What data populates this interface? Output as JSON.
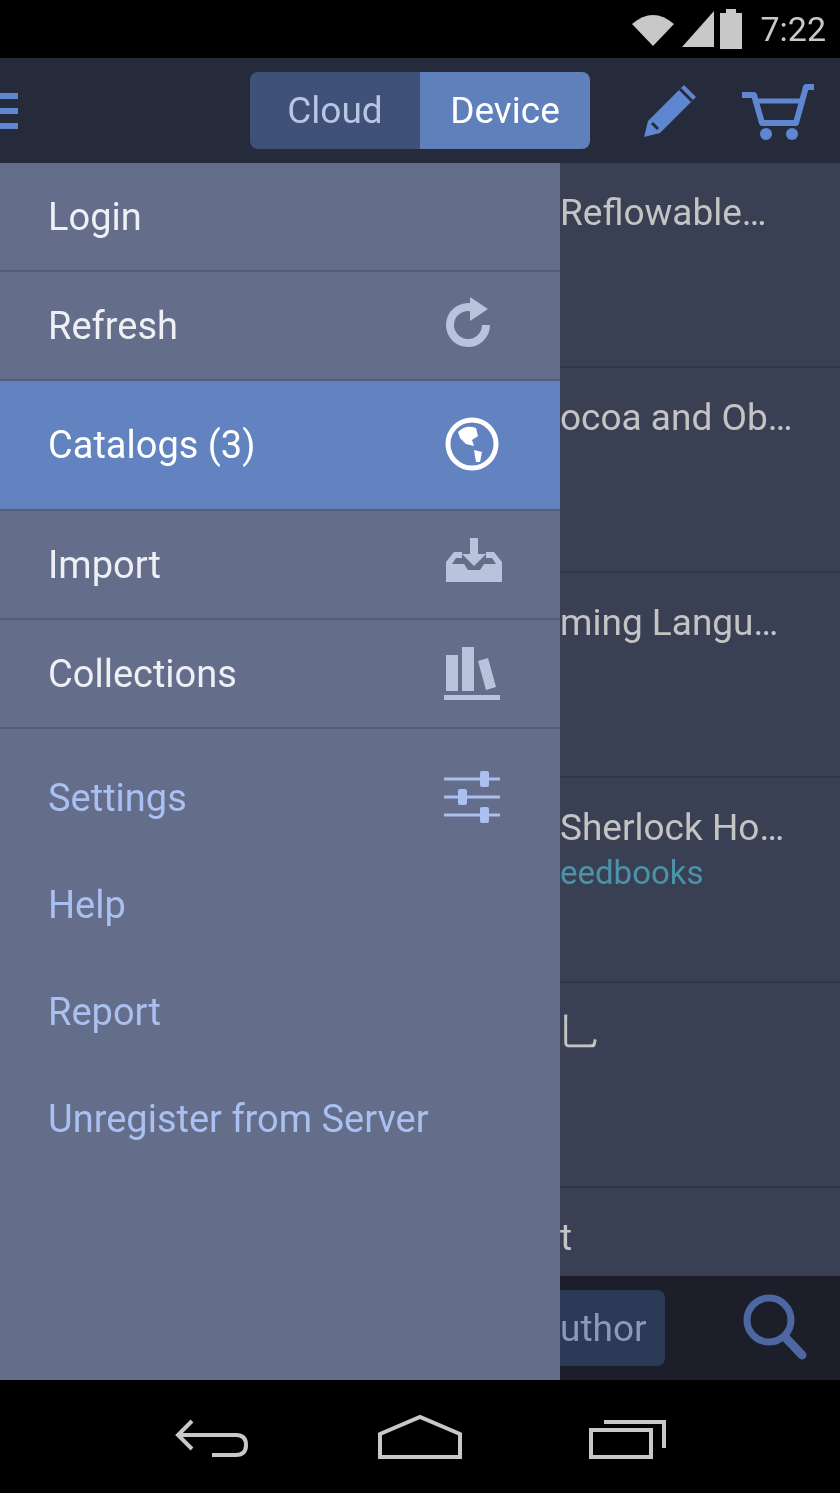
{
  "status_bar": {
    "time": "7:22"
  },
  "app_bar": {
    "segments": [
      {
        "label": "Cloud",
        "selected": false
      },
      {
        "label": "Device",
        "selected": true
      }
    ]
  },
  "drawer": {
    "items": [
      {
        "label": "Login",
        "kind": "primary",
        "selected": false
      },
      {
        "label": "Refresh",
        "kind": "primary",
        "selected": false
      },
      {
        "label": "Catalogs (3)",
        "kind": "primary",
        "selected": true
      },
      {
        "label": "Import",
        "kind": "primary",
        "selected": false
      },
      {
        "label": "Collections",
        "kind": "primary",
        "selected": false
      },
      {
        "label": "Settings",
        "kind": "secondary",
        "selected": false
      },
      {
        "label": "Help",
        "kind": "secondary",
        "selected": false
      },
      {
        "label": "Report",
        "kind": "secondary",
        "selected": false
      },
      {
        "label": "Unregister from Server",
        "kind": "secondary",
        "selected": false
      }
    ]
  },
  "book_list": {
    "rows": [
      {
        "title": "Reflowable…"
      },
      {
        "title": "ocoa and Ob…"
      },
      {
        "title": "ming Langu…"
      },
      {
        "title": "Sherlock Ho…",
        "source": "eedbooks"
      },
      {
        "title": "乚"
      },
      {
        "title": "t"
      }
    ]
  },
  "bottom_bar": {
    "sort_button": "uthor"
  }
}
